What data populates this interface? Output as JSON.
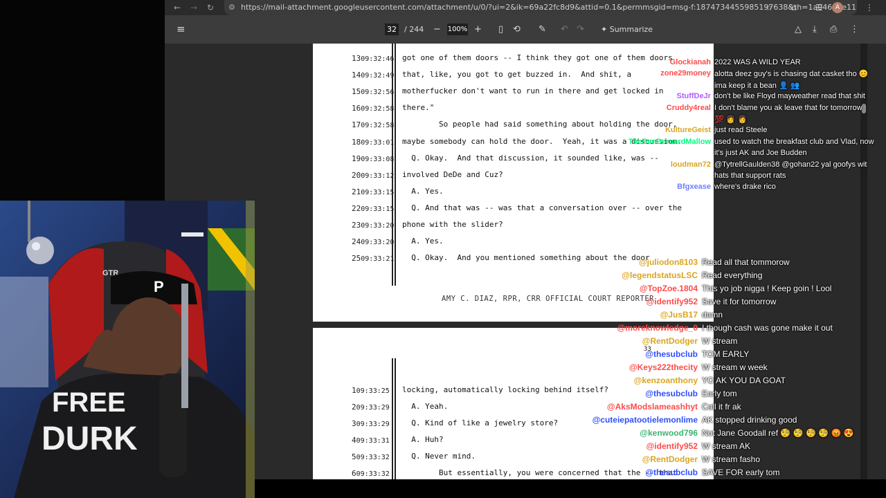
{
  "browser": {
    "url": "https://mail-attachment.googleusercontent.com/attachment/u/0/?ui=2&ik=69a22fc8d9&attid=0.1&permmsgid=msg-f:1874734455985197638&th=1a04650e112ed246...",
    "avatar_letter": "A"
  },
  "pdf_toolbar": {
    "page_current": "32",
    "page_total": "/ 244",
    "zoom": "100%",
    "summarize_label": "Summarize"
  },
  "page1": {
    "lines": [
      {
        "n": "13",
        "t": "09:32:46",
        "text": "got one of them doors -- I think they got one of them doors"
      },
      {
        "n": "14",
        "t": "09:32:49",
        "text": "that, like, you got to get buzzed in.  And shit, a"
      },
      {
        "n": "15",
        "t": "09:32:56",
        "text": "motherfucker don't want to run in there and get locked in"
      },
      {
        "n": "16",
        "t": "09:32:58",
        "text": "there.\""
      },
      {
        "n": "17",
        "t": "09:32:58",
        "text": "        So people had said something about holding the door,"
      },
      {
        "n": "18",
        "t": "09:33:01",
        "text": "maybe somebody can hold the door.  Yeah, it was a discussion."
      },
      {
        "n": "19",
        "t": "09:33:08",
        "text": "  Q. Okay.  And that discussion, it sounded like, was --"
      },
      {
        "n": "20",
        "t": "09:33:12",
        "text": "involved DeDe and Cuz?"
      },
      {
        "n": "21",
        "t": "09:33:15",
        "text": "  A. Yes."
      },
      {
        "n": "22",
        "t": "09:33:15",
        "text": "  Q. And that was -- was that a conversation over -- over the"
      },
      {
        "n": "23",
        "t": "09:33:20",
        "text": "phone with the slider?"
      },
      {
        "n": "24",
        "t": "09:33:20",
        "text": "  A. Yes."
      },
      {
        "n": "25",
        "t": "09:33:21",
        "text": "  Q. Okay.  And you mentioned something about the door"
      }
    ],
    "reporter": "AMY C. DIAZ, RPR, CRR OFFICIAL COURT REPORTER"
  },
  "page2": {
    "page_number": "33",
    "lines": [
      {
        "n": "1",
        "t": "09:33:25",
        "text": "locking, automatically locking behind itself?"
      },
      {
        "n": "2",
        "t": "09:33:29",
        "text": "  A. Yeah."
      },
      {
        "n": "3",
        "t": "09:33:29",
        "text": "  Q. Kind of like a jewelry store?"
      },
      {
        "n": "4",
        "t": "09:33:31",
        "text": "  A. Huh?"
      },
      {
        "n": "5",
        "t": "09:33:32",
        "text": "  Q. Never mind."
      },
      {
        "n": "6",
        "t": "09:33:32",
        "text": "        But essentially, you were concerned that the -- that"
      }
    ]
  },
  "chat_top": [
    {
      "name": "Glockianah",
      "color": "#ff4a4a",
      "msg": "2022 WAS A WILD YEAR"
    },
    {
      "name": "zone29money",
      "color": "#ff4a4a",
      "msg": "alotta deez guy's is chasing dat casket tho 😊"
    },
    {
      "name": "",
      "color": "#ff4a4a",
      "msg": "ima keep it a bean 👤 👥"
    },
    {
      "name": "StuffDeJr",
      "color": "#b05cff",
      "msg": "don't be like Floyd mayweather read that shit"
    },
    {
      "name": "Cruddy4real",
      "color": "#ff4a4a",
      "msg": "I don't blame you ak leave that for tomorrow"
    },
    {
      "name": "",
      "color": "#ff4a4a",
      "msg": "💯 👩 👩"
    },
    {
      "name": "KultureGeist",
      "color": "#daa520",
      "msg": "just read Steele"
    },
    {
      "name": "TheBenBernardMallow",
      "color": "#00ff7f",
      "msg": "used to watch the breakfast club and Vlad, now"
    },
    {
      "name": "",
      "color": "#00ff7f",
      "msg": "it's just AK and Joe Budden"
    },
    {
      "name": "loudman72",
      "color": "#daa520",
      "msg": "@TytrellGaulden38 @gohan22 yal goofys wit"
    },
    {
      "name": "",
      "color": "#daa520",
      "msg": "hats that support rats"
    },
    {
      "name": "Bfgxease",
      "color": "#6f7fff",
      "msg": "where's drake rico"
    }
  ],
  "chat_bottom": [
    {
      "name": "@juliodon8103",
      "color": "#daa520",
      "msg": "Read all that tommorow"
    },
    {
      "name": "@legendstatusLSC",
      "color": "#daa520",
      "msg": "Read everything"
    },
    {
      "name": "@TopZoe.1804",
      "color": "#ff4a4a",
      "msg": "This yo job nigga ! Keep goin ! Lool"
    },
    {
      "name": "@identify952",
      "color": "#ff4a4a",
      "msg": "Save it for tomorrow"
    },
    {
      "name": "@JusB17",
      "color": "#daa520",
      "msg": "damn"
    },
    {
      "name": "@moreknowledge_0",
      "color": "#ff4a4a",
      "msg": "I though cash was gone make it out"
    },
    {
      "name": "@RentDodger",
      "color": "#daa520",
      "msg": "W stream"
    },
    {
      "name": "@thesubclub",
      "color": "#2f4fff",
      "msg": "TOM EARLY"
    },
    {
      "name": "@Keys222thecity",
      "color": "#ff4a4a",
      "msg": "W stream w week"
    },
    {
      "name": "@kenzoanthony",
      "color": "#daa520",
      "msg": "YO AK YOU DA GOAT"
    },
    {
      "name": "@thesubclub",
      "color": "#2f4fff",
      "msg": "Early tom"
    },
    {
      "name": "@AksModslameashhyt",
      "color": "#ff4a4a",
      "msg": "Call it fr ak"
    },
    {
      "name": "@cuteiepatootielemonlime",
      "color": "#2f4fff",
      "msg": "AK stopped drinking good"
    },
    {
      "name": "@kenwood796",
      "color": "#3cb371",
      "msg": "Not Jane Goodall ref 🧐 🧐 🧐 🧐 😡 😍"
    },
    {
      "name": "@identify952",
      "color": "#ff4a4a",
      "msg": "W stream AK"
    },
    {
      "name": "@RentDodger",
      "color": "#daa520",
      "msg": "W stream fasho"
    },
    {
      "name": "@thesubclub",
      "color": "#2f4fff",
      "msg": "SAVE FOR early tom"
    }
  ],
  "webcam": {
    "shirt_text_1": "FREE",
    "shirt_text_2": "DURK",
    "cap_letter": "P",
    "chair_brand": "GTR"
  }
}
